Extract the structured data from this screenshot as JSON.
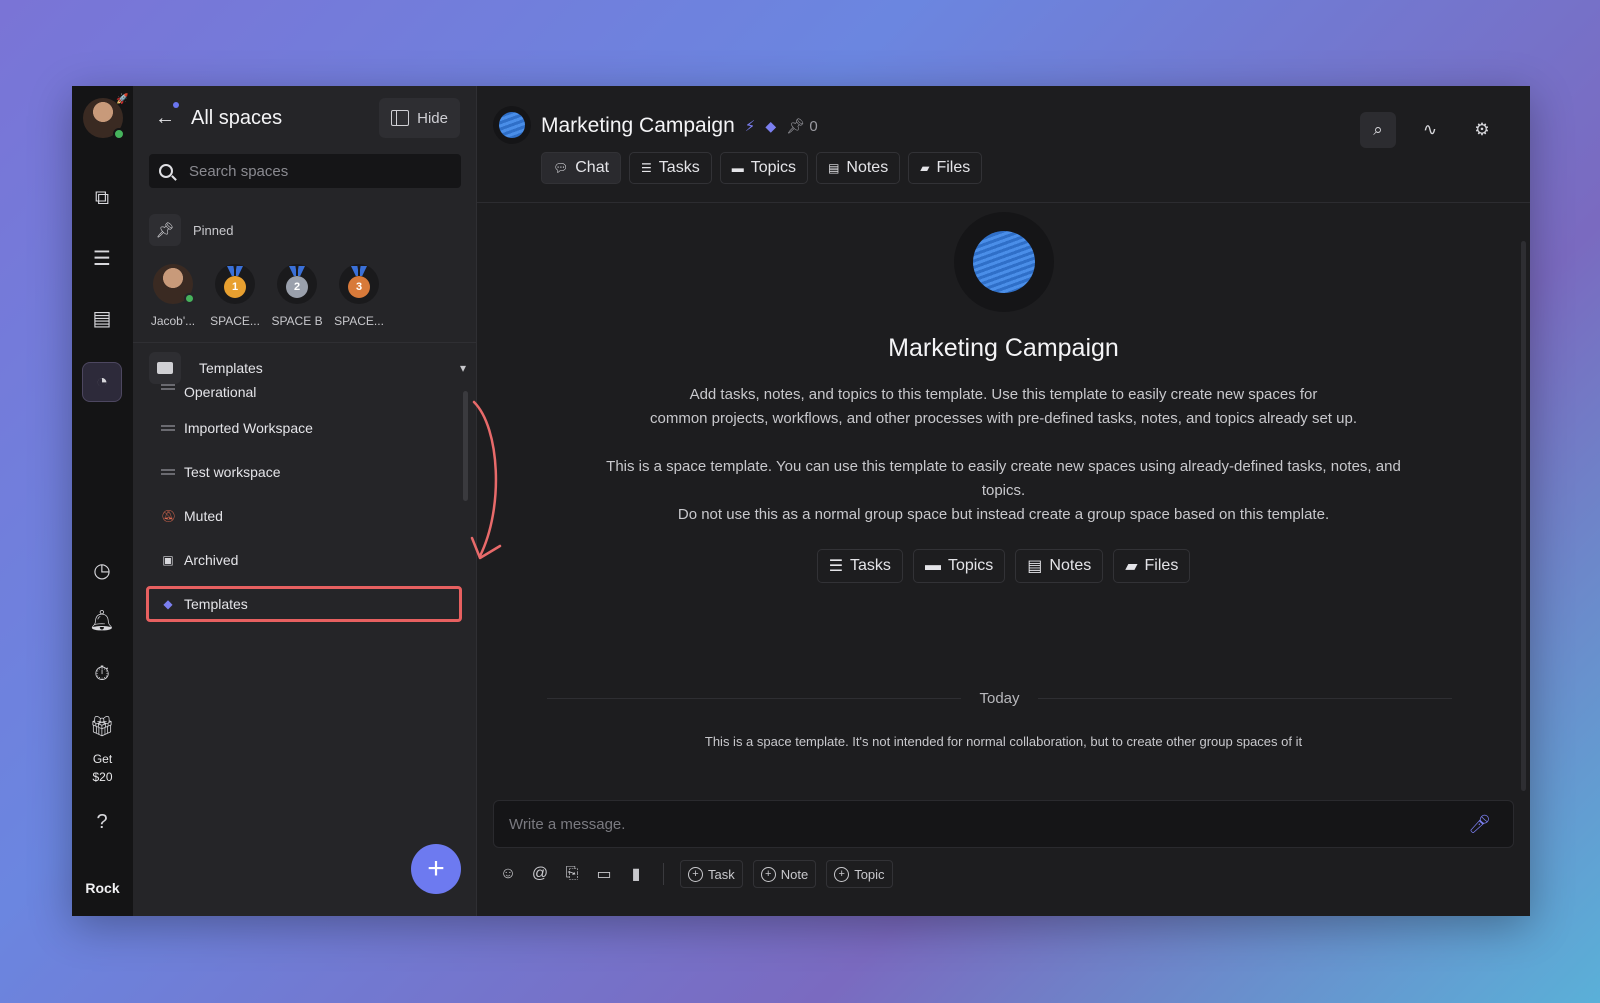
{
  "rail": {
    "icons": [
      "spaces-icon",
      "tasks-list-icon",
      "document-icon",
      "dashboard-icon",
      "clock-icon",
      "bell-icon",
      "timer-icon",
      "gift-icon",
      "help-icon"
    ],
    "gift_label_line1": "Get",
    "gift_label_line2": "$20",
    "brand": "Rock"
  },
  "sidebar": {
    "title": "All spaces",
    "hide_label": "Hide",
    "search_placeholder": "Search spaces",
    "pinned_label": "Pinned",
    "pins": [
      {
        "label": "Jacob'...",
        "medal": ""
      },
      {
        "label": "SPACE...",
        "medal": "1"
      },
      {
        "label": "SPACE B",
        "medal": "2"
      },
      {
        "label": "SPACE...",
        "medal": "3"
      }
    ],
    "group_label": "Templates",
    "items": [
      {
        "label": "Operational"
      },
      {
        "label": "Imported Workspace"
      },
      {
        "label": "Test workspace"
      },
      {
        "label": "Muted"
      },
      {
        "label": "Archived"
      },
      {
        "label": "Templates"
      }
    ],
    "fab_label": "+"
  },
  "header": {
    "title": "Marketing Campaign",
    "pin_count": "0",
    "tabs": [
      {
        "label": "Chat"
      },
      {
        "label": "Tasks"
      },
      {
        "label": "Topics"
      },
      {
        "label": "Notes"
      },
      {
        "label": "Files"
      }
    ]
  },
  "center": {
    "title": "Marketing Campaign",
    "desc1_line1": "Add tasks, notes, and topics to this template. Use this template to easily create new spaces for",
    "desc1_line2": "common projects, workflows, and other processes with pre-defined tasks, notes, and topics already set up.",
    "desc2_line1": "This is a space template. You can use this template to easily create new spaces using already-defined tasks, notes, and",
    "desc2_line2": "topics.",
    "desc2_line3": "Do not use this as a normal group space but instead create a group space based on this template.",
    "chips": [
      {
        "label": "Tasks"
      },
      {
        "label": "Topics"
      },
      {
        "label": "Notes"
      },
      {
        "label": "Files"
      }
    ]
  },
  "feed": {
    "date_divider": "Today",
    "system_message": "This is a space template. It's not intended for normal collaboration, but to create other group spaces of it"
  },
  "composer": {
    "placeholder": "Write a message.",
    "buttons": [
      {
        "label": "Task"
      },
      {
        "label": "Note"
      },
      {
        "label": "Topic"
      }
    ]
  },
  "colors": {
    "accent": "#6d7af0",
    "highlight": "#e76060",
    "online": "#46b35c",
    "medal_gold": "#e8a030",
    "medal_silver": "#9aa0ac",
    "medal_bronze": "#d87a3a"
  }
}
